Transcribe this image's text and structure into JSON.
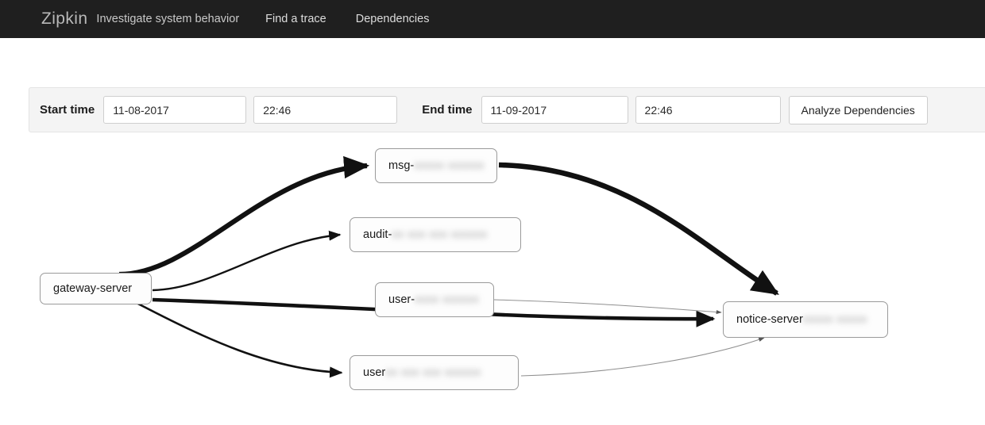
{
  "navbar": {
    "brand": "Zipkin",
    "tagline": "Investigate system behavior",
    "links": [
      {
        "label": "Find a trace"
      },
      {
        "label": "Dependencies"
      }
    ]
  },
  "toolbar": {
    "start_label": "Start time",
    "start_date": "11-08-2017",
    "start_time": "22:46",
    "end_label": "End time",
    "end_date": "11-09-2017",
    "end_time": "22:46",
    "analyze_label": "Analyze Dependencies"
  },
  "graph": {
    "nodes": [
      {
        "id": "gateway",
        "label": "gateway-server",
        "redacted": ""
      },
      {
        "id": "msg",
        "label": "msg-",
        "redacted": "xxxxx xxxxxx"
      },
      {
        "id": "audit",
        "label": "audit-",
        "redacted": "xx xxx xxx xxxxxx"
      },
      {
        "id": "user1",
        "label": "user-",
        "redacted": "xxxx xxxxxx"
      },
      {
        "id": "user2",
        "label": "user",
        "redacted": "xx xxx xxx xxxxxx"
      },
      {
        "id": "notice",
        "label": "notice-server",
        "redacted": "xxxxx xxxxx"
      }
    ],
    "edges": [
      {
        "from": "gateway",
        "to": "msg",
        "weight": "heavy"
      },
      {
        "from": "gateway",
        "to": "audit",
        "weight": "medium"
      },
      {
        "from": "gateway",
        "to": "notice",
        "weight": "heavy"
      },
      {
        "from": "gateway",
        "to": "user2",
        "weight": "medium"
      },
      {
        "from": "msg",
        "to": "notice",
        "weight": "heavy"
      },
      {
        "from": "user1",
        "to": "notice",
        "weight": "light"
      },
      {
        "from": "user2",
        "to": "notice",
        "weight": "light"
      }
    ],
    "edge_color": "#111111",
    "node_border_color": "#9a9a9a"
  }
}
